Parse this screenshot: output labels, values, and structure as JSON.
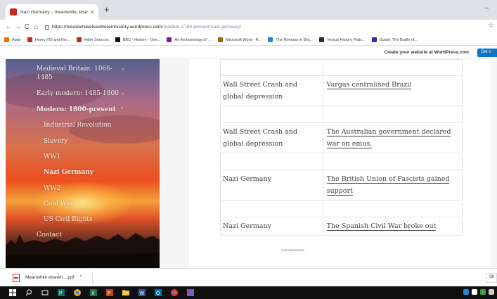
{
  "browser": {
    "tab": {
      "title": "Nazi Germany – meanwhile, elsew",
      "close": "×",
      "new_tab": "+"
    },
    "window": {
      "minimize": "–"
    },
    "nav": {
      "back": "←",
      "forward": "→",
      "reload": "C",
      "home": "⌂",
      "star": "☆"
    },
    "address": {
      "host": "https://meanwhileelsewhereinhistory.wordpress.com",
      "path": "/modern-1789-present/nazi-germany/"
    },
    "bookmarks": [
      {
        "label": "Apps",
        "color": "#e8710a"
      },
      {
        "label": "Henry VIII and the...",
        "color": "#c62828"
      },
      {
        "label": "Hitler Sources",
        "color": "#c62828"
      },
      {
        "label": "BBC - History - Ove...",
        "color": "#111111"
      },
      {
        "label": "An Archaeology of '...",
        "color": "#7b1fa2"
      },
      {
        "label": "Microsoft Word - R...",
        "color": "#8d6e00"
      },
      {
        "label": "The Romans in Brit...",
        "color": "#1e88e5"
      },
      {
        "label": "Versus History Podc...",
        "color": "#263238"
      },
      {
        "label": "Guide: The Battle of...",
        "color": "#4527a0"
      }
    ]
  },
  "wpbar": {
    "create": "Create your website at WordPress.com",
    "get_started": "Get s"
  },
  "sidebar": {
    "items": [
      {
        "label": "Medieval Britain: 1066-",
        "label2": "1485",
        "chevron": "⌄"
      },
      {
        "label": "Early modern: 1485-1800",
        "chevron": "⌄"
      },
      {
        "label": "Modern: 1800-present",
        "chevron": "^"
      },
      {
        "label": "Industrial Revolution"
      },
      {
        "label": "Slavery"
      },
      {
        "label": "WW1"
      },
      {
        "label": "Nazi Germany"
      },
      {
        "label": "WW2"
      },
      {
        "label": "Cold War"
      },
      {
        "label": "US Civil Rights"
      },
      {
        "label": "Contact"
      }
    ]
  },
  "table": {
    "rows": [
      {
        "left": "",
        "right": ""
      },
      {
        "left": "Wall Street Crash and global depression",
        "right": "Vargas centralised Brazil"
      },
      {
        "left": "",
        "right": ""
      },
      {
        "left": "Wall Street Crash and global depression",
        "right": "The Australian government declared war on emus."
      },
      {
        "left": "",
        "right": ""
      },
      {
        "left": "Nazi Germany",
        "right": "The British Union of Fascists gained support"
      },
      {
        "left": "",
        "right": ""
      },
      {
        "left": "Nazi Germany",
        "right": "The Spanish Civil War broke out"
      }
    ]
  },
  "ad_label": "Advertisements",
  "downloads": {
    "file": "Meanwhile elsewh....pdf",
    "chevron": "^",
    "show_all": "Sh"
  },
  "colors": {
    "wp_button": "#0675c4",
    "taskbar": "#101010",
    "tab_strip": "#dee1e6"
  }
}
